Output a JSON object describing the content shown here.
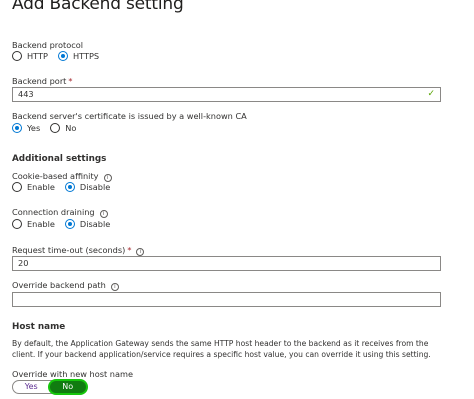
{
  "title": "Add Backend setting",
  "protocol": {
    "label": "Backend protocol",
    "options": [
      "HTTP",
      "HTTPS"
    ],
    "selected": "HTTPS"
  },
  "port": {
    "label": "Backend port",
    "required_mark": "*",
    "value": "443"
  },
  "cert": {
    "label": "Backend server's certificate is issued by a well-known CA",
    "options": [
      "Yes",
      "No"
    ],
    "selected": "Yes"
  },
  "additional": {
    "heading": "Additional settings"
  },
  "affinity": {
    "label": "Cookie-based affinity",
    "options": [
      "Enable",
      "Disable"
    ],
    "selected": "Disable"
  },
  "draining": {
    "label": "Connection draining",
    "options": [
      "Enable",
      "Disable"
    ],
    "selected": "Disable"
  },
  "timeout": {
    "label": "Request time-out (seconds)",
    "required_mark": "*",
    "value": "20"
  },
  "override_path": {
    "label": "Override backend path",
    "value": ""
  },
  "host": {
    "heading": "Host name",
    "description": "By default, the Application Gateway sends the same HTTP host header to the backend as it receives from the client. If your backend application/service requires a specific host value, you can override it using this setting.",
    "override_label": "Override with new host name",
    "toggle": {
      "yes": "Yes",
      "no": "No",
      "selected": "No"
    }
  },
  "icons": {
    "info": "info-icon",
    "check": "checkmark-icon",
    "radio": "radio-icon"
  },
  "colors": {
    "accent": "#0078d4",
    "toggle_on": "#107c10",
    "highlight": "#16c60c",
    "valid": "#57a300",
    "required": "#a4262c"
  }
}
